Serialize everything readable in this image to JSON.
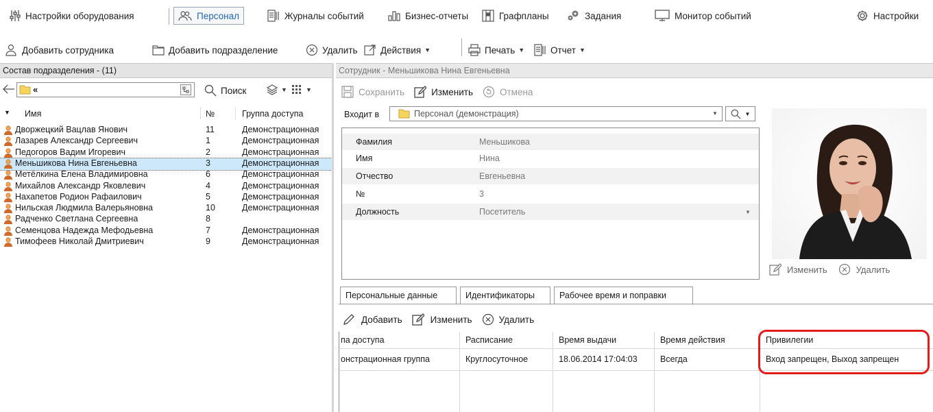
{
  "nav": {
    "hardware_settings": "Настройки оборудования",
    "personnel": "Персонал",
    "event_logs": "Журналы событий",
    "business_reports": "Бизнес-отчеты",
    "schedules": "Графпланы",
    "tasks": "Задания",
    "event_monitor": "Монитор событий",
    "settings": "Настройки"
  },
  "toolbar": {
    "add_employee": "Добавить сотрудника",
    "add_department": "Добавить подразделение",
    "delete": "Удалить",
    "actions": "Действия",
    "print": "Печать",
    "report": "Отчет"
  },
  "left": {
    "title": "Состав подразделения - (11)",
    "folder_path": "«",
    "search": "Поиск",
    "columns": {
      "name": "Имя",
      "number": "№",
      "group": "Группа доступа"
    },
    "rows": [
      {
        "name": "Дворжецкий Вацлав Янович",
        "number": "11",
        "group": "Демонстрационная"
      },
      {
        "name": "Лазарев Александр Сергеевич",
        "number": "1",
        "group": "Демонстрационная"
      },
      {
        "name": "Педогоров Вадим Игоревич",
        "number": "2",
        "group": "Демонстрационная"
      },
      {
        "name": "Меньшикова Нина Евгеньевна",
        "number": "3",
        "group": "Демонстрационная"
      },
      {
        "name": "Метёлкина Елена Владимировна",
        "number": "6",
        "group": "Демонстрационная"
      },
      {
        "name": "Михайлов Александр Яковлевич",
        "number": "4",
        "group": "Демонстрационная"
      },
      {
        "name": "Нахапетов Родион Рафаилович",
        "number": "5",
        "group": "Демонстрационная"
      },
      {
        "name": "Нильская Людмила Валерьяновна",
        "number": "10",
        "group": "Демонстрационная"
      },
      {
        "name": "Радченко Светлана Сергеевна",
        "number": "8",
        "group": ""
      },
      {
        "name": "Семенцова Надежда Мефодьевна",
        "number": "7",
        "group": "Демонстрационная"
      },
      {
        "name": "Тимофеев Николай Дмитриевич",
        "number": "9",
        "group": "Демонстрационная"
      }
    ]
  },
  "right": {
    "title": "Сотрудник - Меньшикова Нина Евгеньевна",
    "save": "Сохранить",
    "edit": "Изменить",
    "cancel": "Отмена",
    "belongs_label": "Входит в",
    "belongs_value": "Персонал (демонстрация)",
    "fields": [
      {
        "label": "Фамилия",
        "value": "Меньшикова"
      },
      {
        "label": "Имя",
        "value": "Нина"
      },
      {
        "label": "Отчество",
        "value": "Евгеньевна"
      },
      {
        "label": "№",
        "value": "3"
      },
      {
        "label": "Должность",
        "value": "Посетитель"
      }
    ],
    "photo_edit": "Изменить",
    "photo_delete": "Удалить",
    "tabs": [
      "Персональные данные",
      "Идентификаторы",
      "Рабочее время и поправки"
    ],
    "ident_add": "Добавить",
    "ident_edit": "Изменить",
    "ident_delete": "Удалить",
    "grid_headers": [
      "па доступа",
      "Расписание",
      "Время выдачи",
      "Время действия",
      "Привилегии"
    ],
    "grid_row": [
      "онстрационная группа",
      "Круглосуточное",
      "18.06.2014 17:04:03",
      "Всегда",
      "Вход запрещен, Выход запрещен"
    ]
  }
}
